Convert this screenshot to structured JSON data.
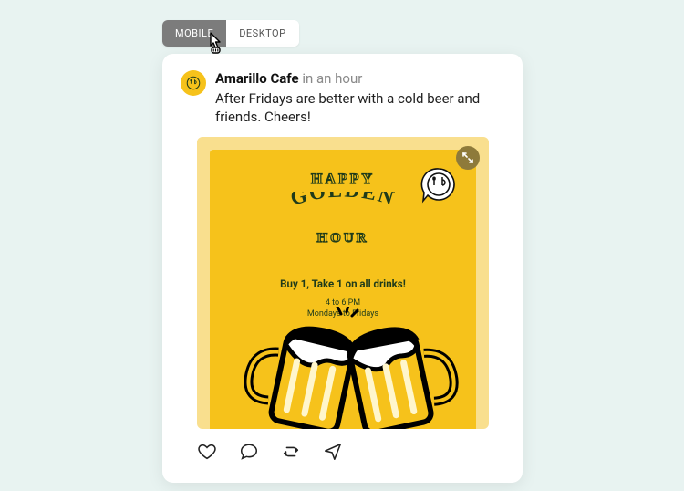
{
  "tabs": {
    "mobile": "MOBILE",
    "desktop": "DESKTOP",
    "active": "mobile"
  },
  "post": {
    "author": "Amarillo Cafe",
    "time": "in an hour",
    "body": "After Fridays are better with a cold beer and friends. Cheers!"
  },
  "media": {
    "line1": "HAPPY",
    "line2": "GOLDEN",
    "line3": "HOUR",
    "promo": "Buy 1, Take 1 on all drinks!",
    "when_time": "4 to 6 PM",
    "when_days": "Mondays to Fridays"
  },
  "icons": {
    "like": "heart-icon",
    "comment": "comment-icon",
    "repost": "repost-icon",
    "share": "share-icon",
    "expand": "expand-icon"
  }
}
